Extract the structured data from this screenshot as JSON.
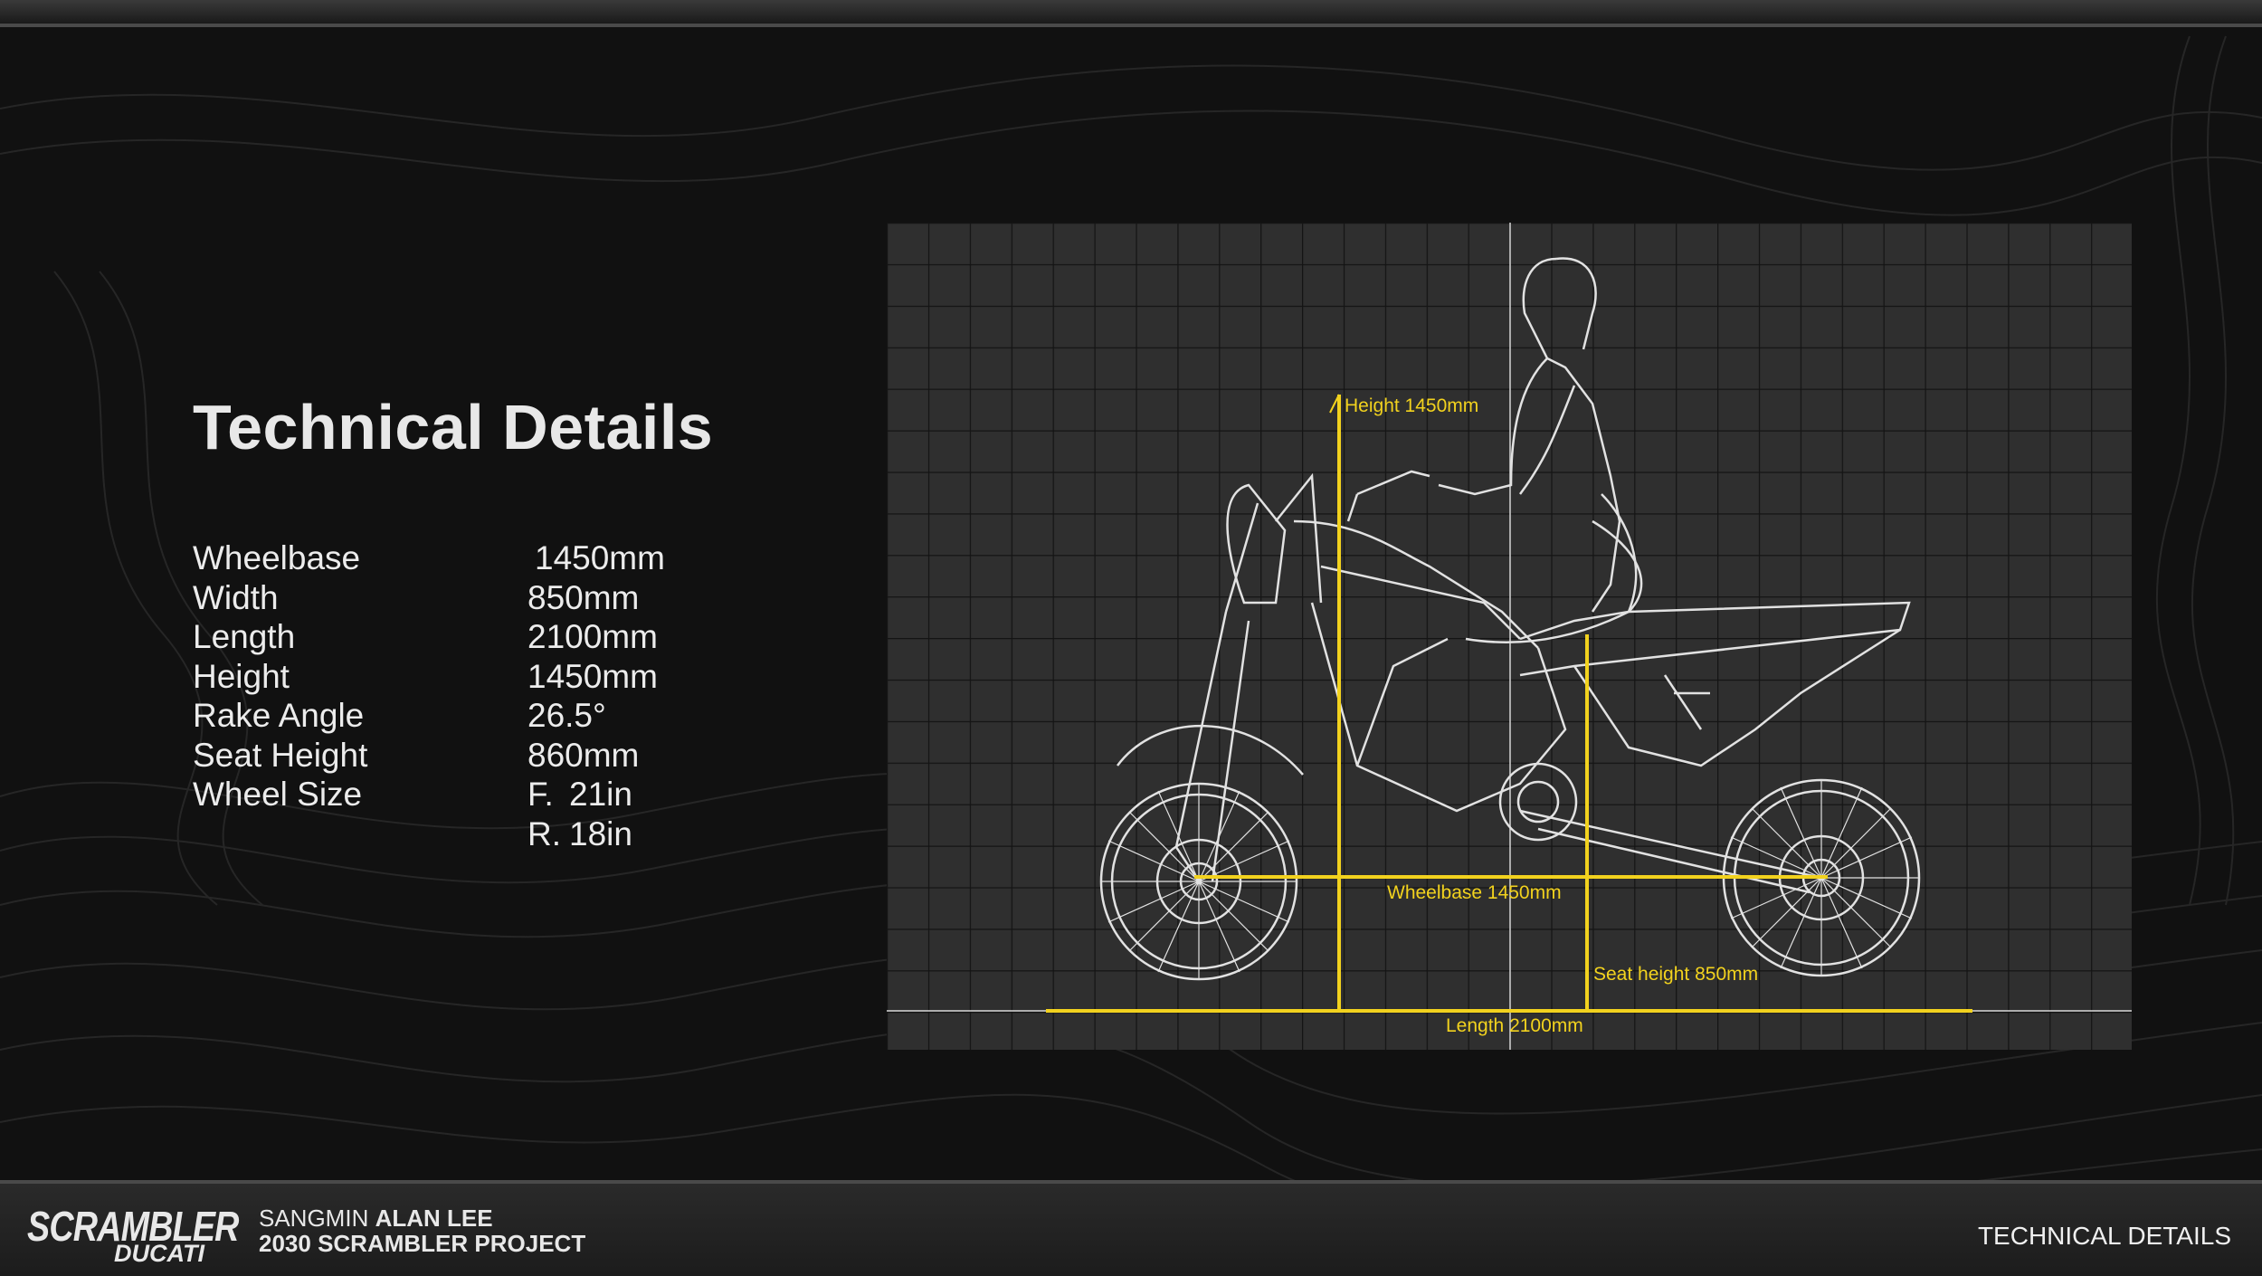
{
  "title": "Technical Details",
  "specs": [
    {
      "label": "Wheelbase",
      "value": "1450mm"
    },
    {
      "label": "Width",
      "value": "850mm"
    },
    {
      "label": "Length",
      "value": "2100mm"
    },
    {
      "label": "Height",
      "value": "1450mm"
    },
    {
      "label": "Rake Angle",
      "value": "26.5°"
    },
    {
      "label": "Seat Height",
      "value": "860mm"
    },
    {
      "label": "Wheel Size",
      "prefix": "F.",
      "value": "21in"
    },
    {
      "label": "",
      "prefix": "R.",
      "value": "18in"
    }
  ],
  "diagram": {
    "height_label": "Height 1450mm",
    "wheelbase_label": "Wheelbase 1450mm",
    "seat_height_label": "Seat height 850mm",
    "length_label": "Length 2100mm"
  },
  "footer": {
    "logo_main": "SCRAMBLER",
    "logo_sub": "DUCATI",
    "author_first": "SANGMIN",
    "author_name": "ALAN LEE",
    "project": "2030 SCRAMBLER PROJECT",
    "section": "TECHNICAL DETAILS"
  },
  "colors": {
    "background": "#111111",
    "grid_panel": "#2f2f2f",
    "dimension_yellow": "#f2d21e",
    "wireframe": "#e0e0e0"
  }
}
